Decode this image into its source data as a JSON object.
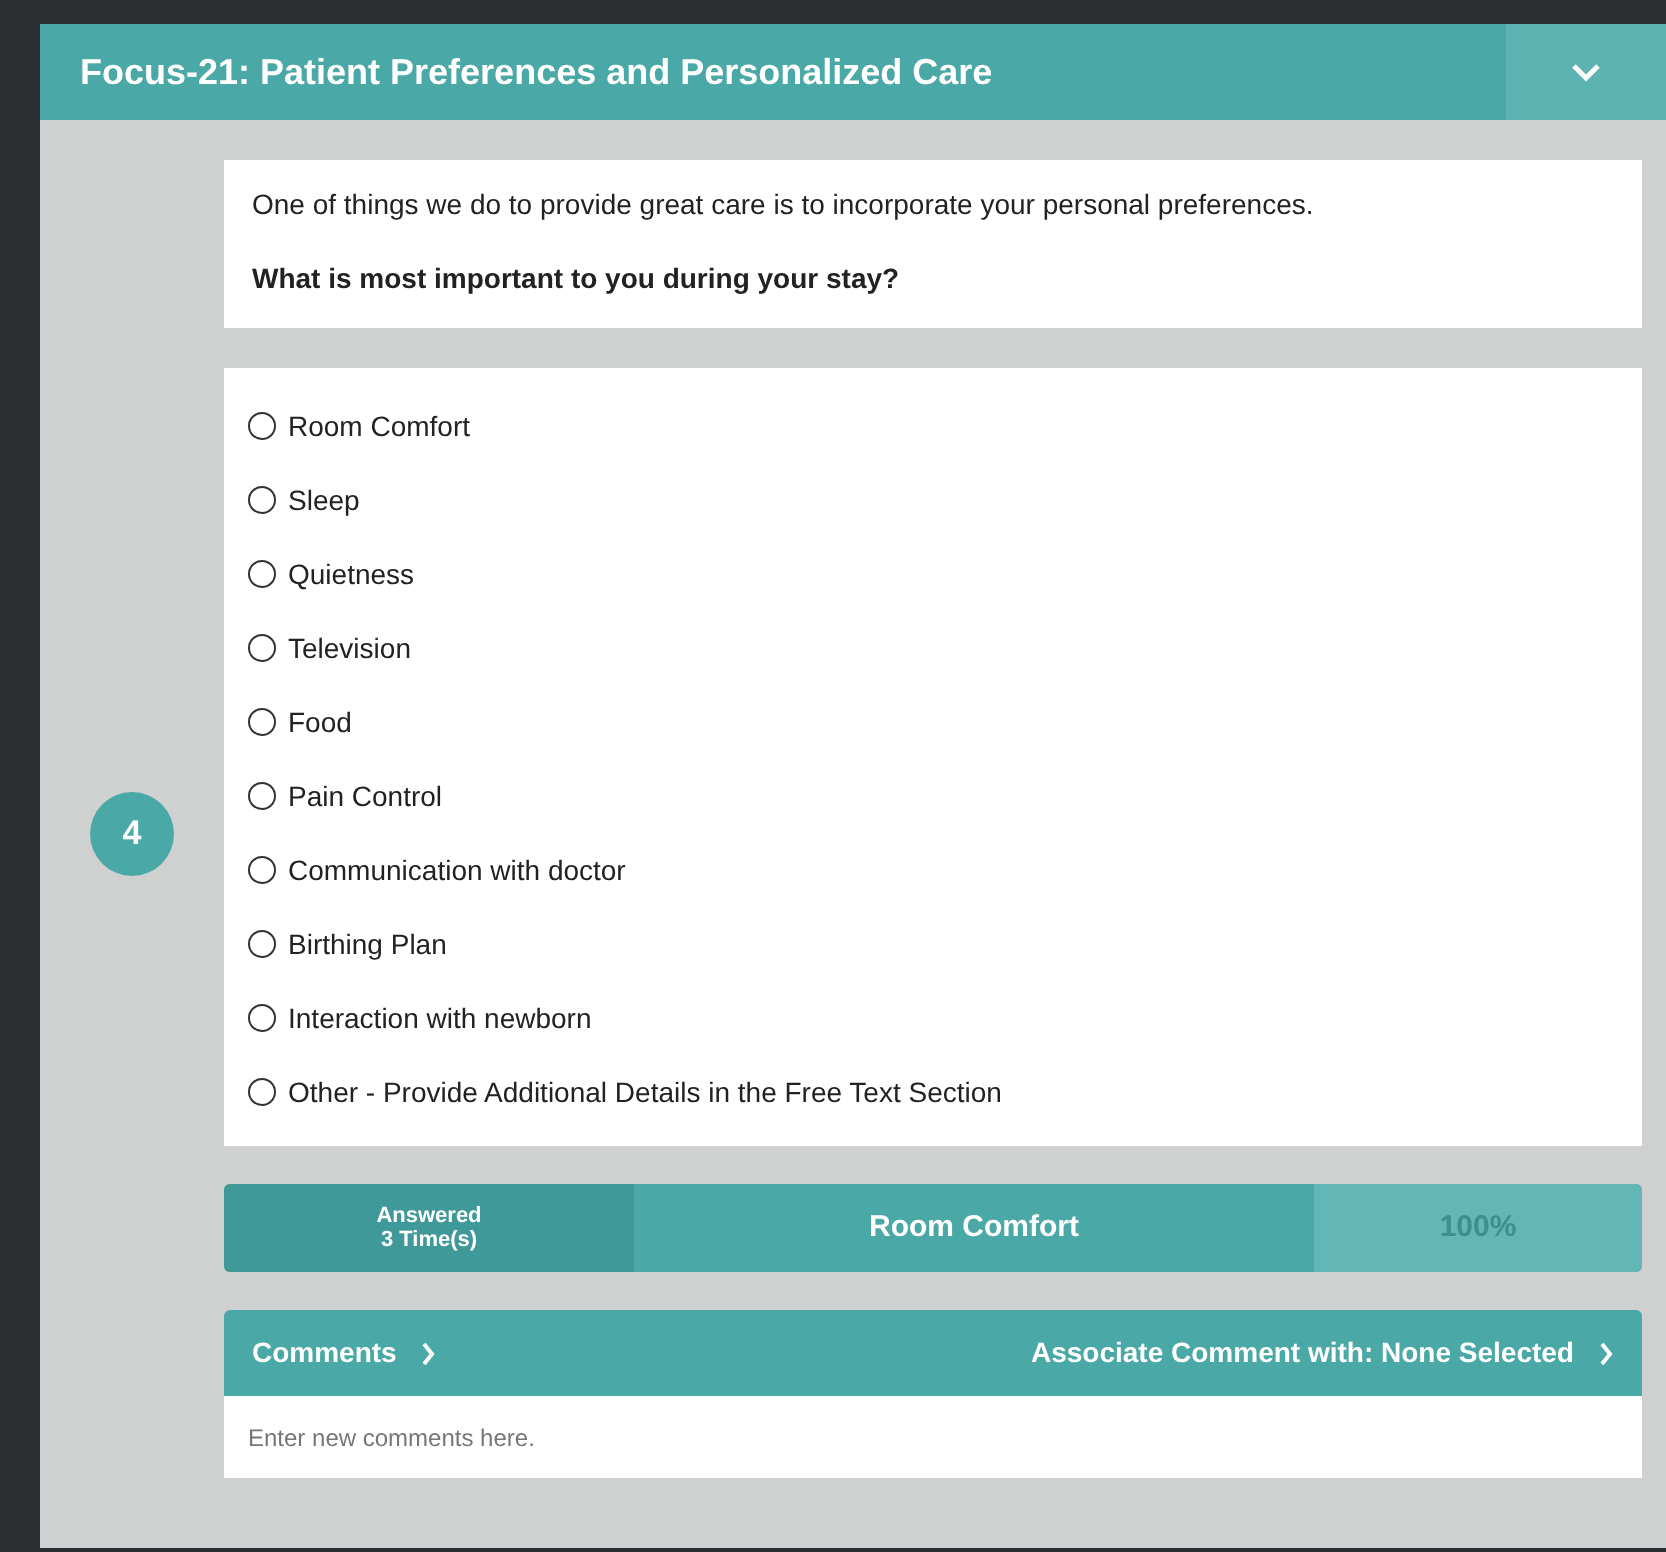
{
  "header": {
    "title": "Focus-21: Patient Preferences and Personalized Care",
    "expanded": true
  },
  "question_number": "4",
  "intro": {
    "text": "One of things we do to provide great care is to incorporate your personal preferences.",
    "question": "What is most important to you during your stay?"
  },
  "options": [
    {
      "label": "Room Comfort",
      "selected": false
    },
    {
      "label": "Sleep",
      "selected": false
    },
    {
      "label": "Quietness",
      "selected": false
    },
    {
      "label": "Television",
      "selected": false
    },
    {
      "label": "Food",
      "selected": false
    },
    {
      "label": "Pain Control",
      "selected": false
    },
    {
      "label": "Communication with doctor",
      "selected": false
    },
    {
      "label": "Birthing Plan",
      "selected": false
    },
    {
      "label": "Interaction with newborn",
      "selected": false
    },
    {
      "label": "Other - Provide Additional Details in the Free Text Section",
      "selected": false
    }
  ],
  "answer_bar": {
    "answered": "Answered",
    "times": "3 Time(s)",
    "answer": "Room Comfort",
    "percent": "100%"
  },
  "comments": {
    "label": "Comments",
    "associate": "Associate Comment with: None Selected",
    "placeholder": "Enter new comments here."
  }
}
